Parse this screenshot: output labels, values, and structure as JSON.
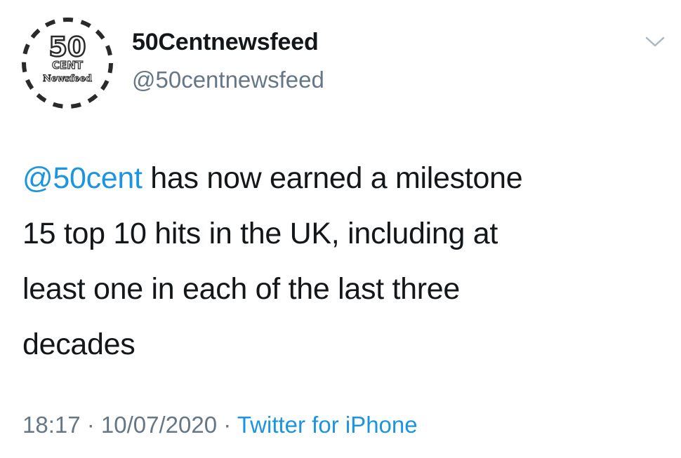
{
  "account": {
    "display_name": "50Centnewsfeed",
    "handle": "@50centnewsfeed",
    "avatar": {
      "line1": "50",
      "line2": "CENT",
      "line3": "Newsfeed",
      "icon": "avatar-logo-icon"
    }
  },
  "menu": {
    "icon": "chevron-down-icon"
  },
  "tweet": {
    "mention": "@50cent",
    "text_line1": " has now earned a milestone",
    "text_line2": "15 top 10 hits in the UK, including at",
    "text_line3": "least one in each of the last three",
    "text_line4": "decades"
  },
  "meta": {
    "time": "18:17",
    "separator1": " · ",
    "date": "10/07/2020",
    "separator2": " · ",
    "source": "Twitter for iPhone"
  },
  "colors": {
    "link": "#1b95e0",
    "secondary": "#657786",
    "primary": "#14171a"
  }
}
